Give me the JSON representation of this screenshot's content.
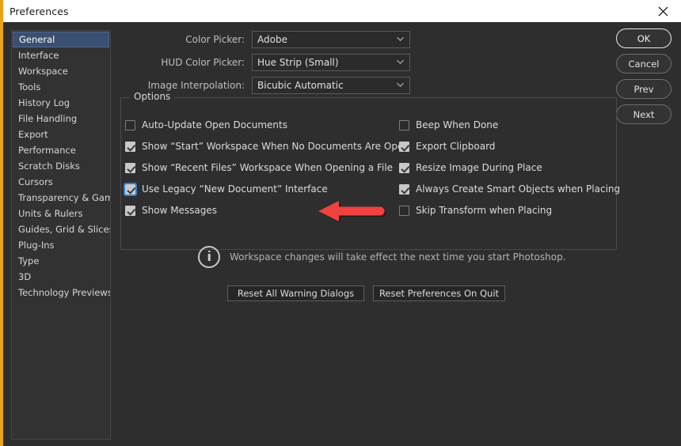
{
  "window": {
    "title": "Preferences",
    "close_icon": "close-icon",
    "accent_border": "#e8a317"
  },
  "sidebar": {
    "items": [
      {
        "label": "General",
        "selected": true
      },
      {
        "label": "Interface",
        "selected": false
      },
      {
        "label": "Workspace",
        "selected": false
      },
      {
        "label": "Tools",
        "selected": false
      },
      {
        "label": "History Log",
        "selected": false
      },
      {
        "label": "File Handling",
        "selected": false
      },
      {
        "label": "Export",
        "selected": false
      },
      {
        "label": "Performance",
        "selected": false
      },
      {
        "label": "Scratch Disks",
        "selected": false
      },
      {
        "label": "Cursors",
        "selected": false
      },
      {
        "label": "Transparency & Gamut",
        "selected": false
      },
      {
        "label": "Units & Rulers",
        "selected": false
      },
      {
        "label": "Guides, Grid & Slices",
        "selected": false
      },
      {
        "label": "Plug-Ins",
        "selected": false
      },
      {
        "label": "Type",
        "selected": false
      },
      {
        "label": "3D",
        "selected": false
      },
      {
        "label": "Technology Previews",
        "selected": false
      }
    ]
  },
  "actions": {
    "ok": "OK",
    "cancel": "Cancel",
    "prev": "Prev",
    "next": "Next"
  },
  "form": {
    "rows": [
      {
        "label": "Color Picker:",
        "value": "Adobe"
      },
      {
        "label": "HUD Color Picker:",
        "value": "Hue Strip (Small)"
      },
      {
        "label": "Image Interpolation:",
        "value": "Bicubic Automatic"
      }
    ]
  },
  "options": {
    "legend": "Options",
    "left_column": [
      {
        "label": "Auto-Update Open Documents",
        "checked": false,
        "focused": false
      },
      {
        "label": "Show “Start” Workspace When No Documents Are Open",
        "checked": true,
        "focused": false
      },
      {
        "label": "Show “Recent Files” Workspace When Opening a File",
        "checked": true,
        "focused": false
      },
      {
        "label": "Use Legacy “New Document” Interface",
        "checked": true,
        "focused": true
      },
      {
        "label": "Show Messages",
        "checked": true,
        "focused": false
      }
    ],
    "right_column": [
      {
        "label": "Beep When Done",
        "checked": false,
        "focused": false
      },
      {
        "label": "Export Clipboard",
        "checked": true,
        "focused": false
      },
      {
        "label": "Resize Image During Place",
        "checked": true,
        "focused": false
      },
      {
        "label": "Always Create Smart Objects when Placing",
        "checked": true,
        "focused": false
      },
      {
        "label": "Skip Transform when Placing",
        "checked": false,
        "focused": false
      }
    ],
    "note": {
      "icon": "info-icon",
      "text": "Workspace changes will take effect the next time you start Photoshop."
    }
  },
  "footer": {
    "reset_warnings": "Reset All Warning Dialogs",
    "reset_prefs": "Reset Preferences On Quit"
  },
  "annotation": {
    "arrow_color": "#f0423e",
    "direction": "left",
    "points_at": "Use Legacy “New Document” Interface"
  }
}
